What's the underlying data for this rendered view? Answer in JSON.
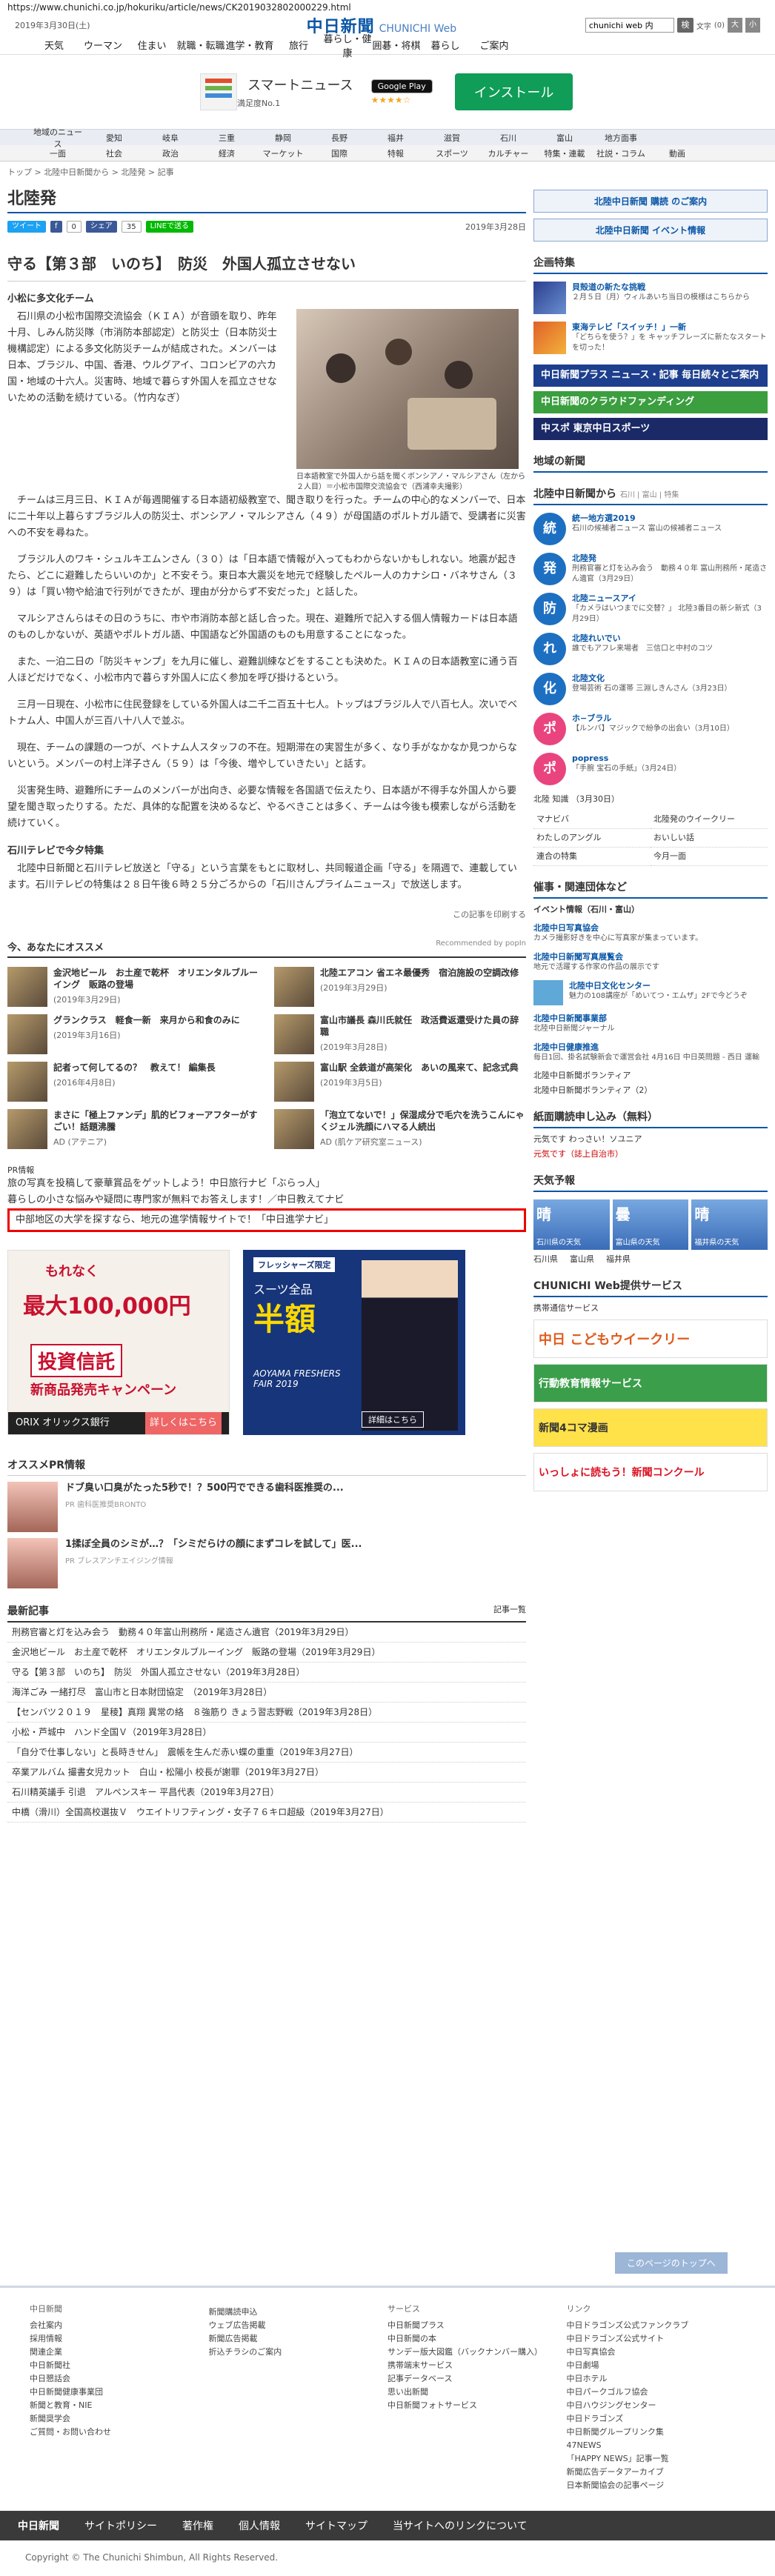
{
  "url": "https://www.chunichi.co.jp/hokuriku/article/news/CK2019032802000229.html",
  "topbar": {
    "date": "2019年3月30日(土)",
    "logo_main": "中日新聞",
    "logo_sub": "CHUNICHI Web",
    "search_value": "chunichi web 内",
    "search_btn": "検",
    "font_label": "文字",
    "font_size_value": "(0)",
    "font_up": "大",
    "font_down": "小"
  },
  "gnav": [
    "天気",
    "ウーマン",
    "住まい",
    "就職・転職",
    "進学・教育",
    "旅行",
    "暮らし・健康",
    "囲碁・将棋",
    "暮らし",
    "ご案内"
  ],
  "ad_top": {
    "title": "スマートニュース",
    "sub": "満足度No.1",
    "gplay": "Google Play",
    "stars": "★★★★☆",
    "install": "インストール"
  },
  "rnav1": [
    "地域のニュース",
    "愛知",
    "岐阜",
    "三重",
    "静岡",
    "長野",
    "福井",
    "滋賀",
    "石川",
    "富山",
    "地方面事"
  ],
  "rnav2": [
    "一面",
    "社会",
    "政治",
    "経済",
    "マーケット",
    "国際",
    "特報",
    "スポーツ",
    "カルチャー",
    "特集・連載",
    "社説・コラム",
    "動画"
  ],
  "breadcrumb": "トップ > 北陸中日新聞から > 北陸発 > 記事",
  "region": "北陸発",
  "share": {
    "tweet": "ツイート",
    "fb": "f",
    "fb_count": "0",
    "share": "シェア",
    "share_count": "35",
    "line": "LINEで送る"
  },
  "article": {
    "date": "2019年3月28日",
    "title": "守る【第３部　いのち】　防災　外国人孤立させない",
    "subtitle": "小松に多文化チーム",
    "lead": "石川県の小松市国際交流協会（ＫＩＡ）が音頭を取り、昨年十月、しみん防災隊（市消防本部認定）と防災士（日本防災士機構認定）による多文化防災チームが結成された。メンバーは日本、ブラジル、中国、香港、ウルグアイ、コロンビアの六カ国・地域の十六人。災害時、地域で暮らす外国人を孤立させないための活動を続けている。（竹内なぎ）",
    "photo_caption": "日本語教室で外国人から話を聞くボンシアノ・マルシアさん（左から２人目）＝小松市国際交流協会で（西浦幸夫撮影）",
    "paragraphs": [
      "チームは三月三日、ＫＩＡが毎週開催する日本語初級教室で、聞き取りを行った。チームの中心的なメンバーで、日本に二十年以上暮らすブラジル人の防災士、ボンシアノ・マルシアさん（４９）が母国語のポルトガル語で、受講者に災害への不安を尋ねた。",
      "ブラジル人のワキ・シュルキエムンさん（３０）は「日本語で情報が入ってもわからないかもしれない。地震が起きたら、どこに避難したらいいのか」と不安そう。東日本大震災を地元で経験したペルー人のカナシロ・バネサさん（３９）は「買い物や給油で行列ができたが、理由が分からず不安だった」と話した。",
      "マルシアさんらはその日のうちに、市や市消防本部と話し合った。現在、避難所で記入する個人情報カードは日本語のものしかないが、英語やポルトガル語、中国語など外国語のものも用意することになった。",
      "また、一泊二日の「防災キャンプ」を九月に催し、避難訓練などをすることも決めた。ＫＩＡの日本語教室に通う百人ほどだけでなく、小松市内で暮らす外国人に広く参加を呼び掛けるという。",
      "三月一日現在、小松市に住民登録をしている外国人は二千二百五十七人。トップはブラジル人で八百七人。次いでベトナム人、中国人が三百八十八人で並ぶ。",
      "現在、チームの課題の一つが、ベトナム人スタッフの不在。短期滞在の実習生が多く、なり手がなかなか見つからないという。メンバーの村上洋子さん（５９）は「今後、増やしていきたい」と話す。",
      "災害発生時、避難所にチームのメンバーが出向き、必要な情報を各国語で伝えたり、日本語が不得手な外国人から要望を聞き取ったりする。ただ、具体的な配置を決めるなど、やるべきことは多く、チームは今後も模索しながら活動を続けていく。"
    ],
    "tv_title": "石川テレビで今夕特集",
    "tv_text": "北陸中日新聞と石川テレビ放送と「守る」という言葉をもとに取材し、共同報道企画「守る」を隔週で、連載しています。石川テレビの特集は２８日午後６時２５分ごろからの「石川さんプライムニュース」で放送します。",
    "print_note": "この記事を印刷する"
  },
  "recommend": {
    "title": "今、あなたにオススメ",
    "by": "Recommended by popIn",
    "items": [
      {
        "t": "金沢地ビール　お土産で乾杯　オリエンタルブルーイング　販路の登場",
        "d": "(2019年3月29日)"
      },
      {
        "t": "北陸エアコン 省エネ最優秀　宿泊施設の空調改修",
        "d": "(2019年3月29日)"
      },
      {
        "t": "グランクラス　軽食一新　来月から和食のみに",
        "d": "(2019年3月16日)"
      },
      {
        "t": "富山市議長 森川氏就任　政活費返還受けた員の辞職",
        "d": "(2019年3月28日)"
      },
      {
        "t": "記者って何してるの？　教えて！ 編集長",
        "d": "(2016年4月8日)"
      },
      {
        "t": "富山駅 全鉄道が高架化　あいの風来て、記念式典",
        "d": "(2019年3月5日)"
      },
      {
        "t": "まさに「極上ファンデ」肌的ビフォーアフターがすごい！話題沸騰",
        "d": "AD (アテニア)"
      },
      {
        "t": "「泡立てないで！」保湿成分で毛穴を洗うこんにゃくジェル洗顔にハマる人続出",
        "d": "AD (肌ケア研究室ニュース)"
      }
    ]
  },
  "pr": {
    "label": "PR情報",
    "items": [
      "旅の写真を投稿して豪華賞品をゲットしよう！中日旅行ナビ「ぶらっ人」",
      "暮らしの小さな悩みや疑問に専門家が無料でお答えします！／中日教えてナビ",
      "中部地区の大学を探すなら、地元の進学情報サイトで！「中日進学ナビ」"
    ]
  },
  "ads2": {
    "a1_line1": "もれなく",
    "a1_big": "最大100,000円",
    "a1_box": "投資信託",
    "a1_line3": "新商品発売キャンペーン",
    "a1_brand": "ORIX オリックス銀行",
    "a1_btn": "詳しくはこちら",
    "a2_tag": "フレッシャーズ限定",
    "a2_h": "スーツ全品",
    "a2_hh": "半額",
    "a2_f": "AOYAMA FRESHERS FAIR 2019",
    "a2_btn": "詳細はこちら"
  },
  "osusume": {
    "title": "オススメPR情報",
    "items": [
      {
        "t": "ドブ臭い口臭がたった5秒で！？500円でできる歯科医推奨の...",
        "d": "PR 歯科医推奨BRONTO"
      },
      {
        "t": "1揉ぼ全員のシミが…？「シミだらけの顔にまずコレを試して」医...",
        "d": "PR ブレスアンチエイジング情報"
      }
    ]
  },
  "latest": {
    "title": "最新記事",
    "more": "記事一覧",
    "items": [
      "刑務官審と灯を込み会う　動務４０年富山刑務所・尾造さん遺官（2019年3月29日）",
      "金沢地ビール　お土産で乾杯　オリエンタルブルーイング　販路の登場（2019年3月29日）",
      "守る【第３部　いのち】　防災　外国人孤立させない（2019年3月28日）",
      "海洋ごみ 一緒打尽　富山市と日本財団協定　（2019年3月28日）",
      "【センバツ２０１９　星稜】真翔 異常の絡　８強筋り きょう習志野戦（2019年3月28日）",
      "小松・芦城中　ハンド全国Ｖ（2019年3月28日）",
      "「自分で仕事しない」と長時きせん」　震帳を生んだ赤い蝶の重重（2019年3月27日）",
      "卒業アルバム 撮書女児カット　白山・松陽小 校長が謝罪（2019年3月27日）",
      "石川精英議手 引退　アルペンスキー 平昌代表（2019年3月27日）",
      "中橋（滑川）全国高校選抜Ｖ　ウエイトリフティング・女子７６キロ超級（2019年3月27日）"
    ]
  },
  "side": {
    "kodoku": "北陸中日新聞 購読 のご案内",
    "events_btn": "北陸中日新聞 イベント情報",
    "kikaku_title": "企画特集",
    "kikaku": [
      {
        "t": "貝殻道の新たな挑戦",
        "d": "２月５日（月）ウィルあいち当日の模様はこちらから"
      },
      {
        "t": "東海テレビ「スイッチ！」一新",
        "d": "「どちらを使う？」を キャッチフレーズに新たなスタートを切った！"
      }
    ],
    "banner1": "中日新聞プラス ニュース・記事 毎日続々とご案内",
    "banner2": "中日新聞のクラウドファンディング",
    "banner3": "中スポ 東京中日スポーツ",
    "chiiki_title": "地域の新聞",
    "kara_title": "北陸中日新聞から",
    "kara_links": "石川 | 富山 | 特集",
    "kara": [
      {
        "b": "統",
        "t": "統一地方選2019",
        "d": "石川の候補者ニュース\n富山の候補者ニュース"
      },
      {
        "b": "発",
        "t": "北陸発",
        "d": "刑務官審と灯を込み会う　動務４０年 富山刑務所・尾造さん遺官（3月29日）"
      },
      {
        "b": "防",
        "t": "北陸ニュースアイ",
        "d": "「カメラはいつまでに交替？」 北陸3番目の新シ新式（3月29日）"
      },
      {
        "b": "れ",
        "t": "北陸れいでい",
        "d": "誰でもアフレ来場者　三信口と中村のコツ"
      },
      {
        "b": "化",
        "t": "北陸文化",
        "d": "登場芸術 石の運帯 三淵しきんさん（3月23日）"
      },
      {
        "b": "ポ",
        "t": "ホ−ブラル",
        "d": "【ルンバ】マジックで紛争の出会い（3月10日）"
      },
      {
        "b": "ポ",
        "t": "popress",
        "d": "「手腕 宝石の手紙」（3月24日）"
      }
    ],
    "fukui": "北陸 知識",
    "fukui_date": "（3月30日）",
    "links": [
      "マナビバ",
      "北陸発のウイークリー",
      "わたしのアングル",
      "おいしい話",
      "連合の特集",
      "今月一面"
    ],
    "event_title": "催事・関連団体など",
    "event_sub": "イベント情報（石川・富山）",
    "events": [
      {
        "t": "北陸中日写真協会",
        "d": "カメラ撮影好きを中心に写真家が集まっています。"
      },
      {
        "t": "北陸中日新聞写真展覧会",
        "d": "地元で活躍する作家の作品の展示です"
      },
      {
        "t": "北陸中日文化センター",
        "d": "魅力の108講座が「めいてつ・エムザ」2Fで今どうぞ"
      },
      {
        "t": "北陸中日新聞事業部",
        "d": "北陸中日新聞ジャーナル"
      },
      {
        "t": "北陸中日健康推進",
        "d": "毎日1回、掛名試験新会で運営会社 4月16日 中日英問題 - 西日 運輸"
      }
    ],
    "event_more1": "北陸中日新聞ボランティア",
    "event_more2": "北陸中日新聞ボランティア（2）",
    "paper_title": "紙面購読申し込み（無料）",
    "paper1": "元気です わっさい！ソユニア",
    "paper2": "元気です（誌上自治市）",
    "weather_title": "天気予報",
    "weather": [
      {
        "n": "石川県の天気",
        "v": "晴"
      },
      {
        "n": "富山県の天気",
        "v": "曇"
      },
      {
        "n": "福井県の天気",
        "v": "晴"
      }
    ],
    "weather_links": [
      "石川県",
      "富山県",
      "福井県"
    ],
    "svc_title": "CHUNICHI Web提供サービス",
    "svc_sub": "携帯通信サービス",
    "sb1": "中日 こどもウイークリー",
    "sb2": "行動教育情報サービス",
    "sb3": "新聞4コマ漫画",
    "sb4": "いっしょに読もう！新聞コンクール"
  },
  "totop": "このページのトップへ",
  "footer": {
    "cols": [
      {
        "ttl": "中日新聞",
        "items": [
          "会社案内",
          "採用情報",
          "関連企業",
          "中日新聞社",
          "中日懇話会",
          "中日新聞健康事業団",
          "新聞と教育・NIE",
          "新聞奨学会",
          "ご質問・お問い合わせ"
        ]
      },
      {
        "ttl": "",
        "items": [
          "新聞購読申込",
          "ウェブ広告掲載",
          "新聞広告掲載",
          "折込チラシのご案内"
        ]
      },
      {
        "ttl": "サービス",
        "items": [
          "中日新聞プラス",
          "中日新聞の本",
          "サンデー版大図鑑（バックナンバー購入）",
          "携帯端末サービス",
          "記事データベース",
          "思い出新聞",
          "中日新聞フォトサービス"
        ]
      },
      {
        "ttl": "リンク",
        "items": [
          "中日ドラゴンズ公式ファンクラブ",
          "中日ドラゴンズ公式サイト",
          "中日写真協会",
          "中日劇場",
          "中日ホテル",
          "中日パークゴルフ協会",
          "中日ハウジングセンター",
          "中日ドラゴンズ",
          "中日新聞グループリンク集",
          "47NEWS",
          "「HAPPY NEWS」記事一覧",
          "新聞広告データアーカイブ",
          "日本新聞協会の記事ページ"
        ]
      }
    ],
    "bar": [
      "中日新聞",
      "サイトポリシー",
      "著作権",
      "個人情報",
      "サイトマップ",
      "当サイトへのリンクについて"
    ],
    "copy": "Copyright © The Chunichi Shimbun, All Rights Reserved."
  }
}
